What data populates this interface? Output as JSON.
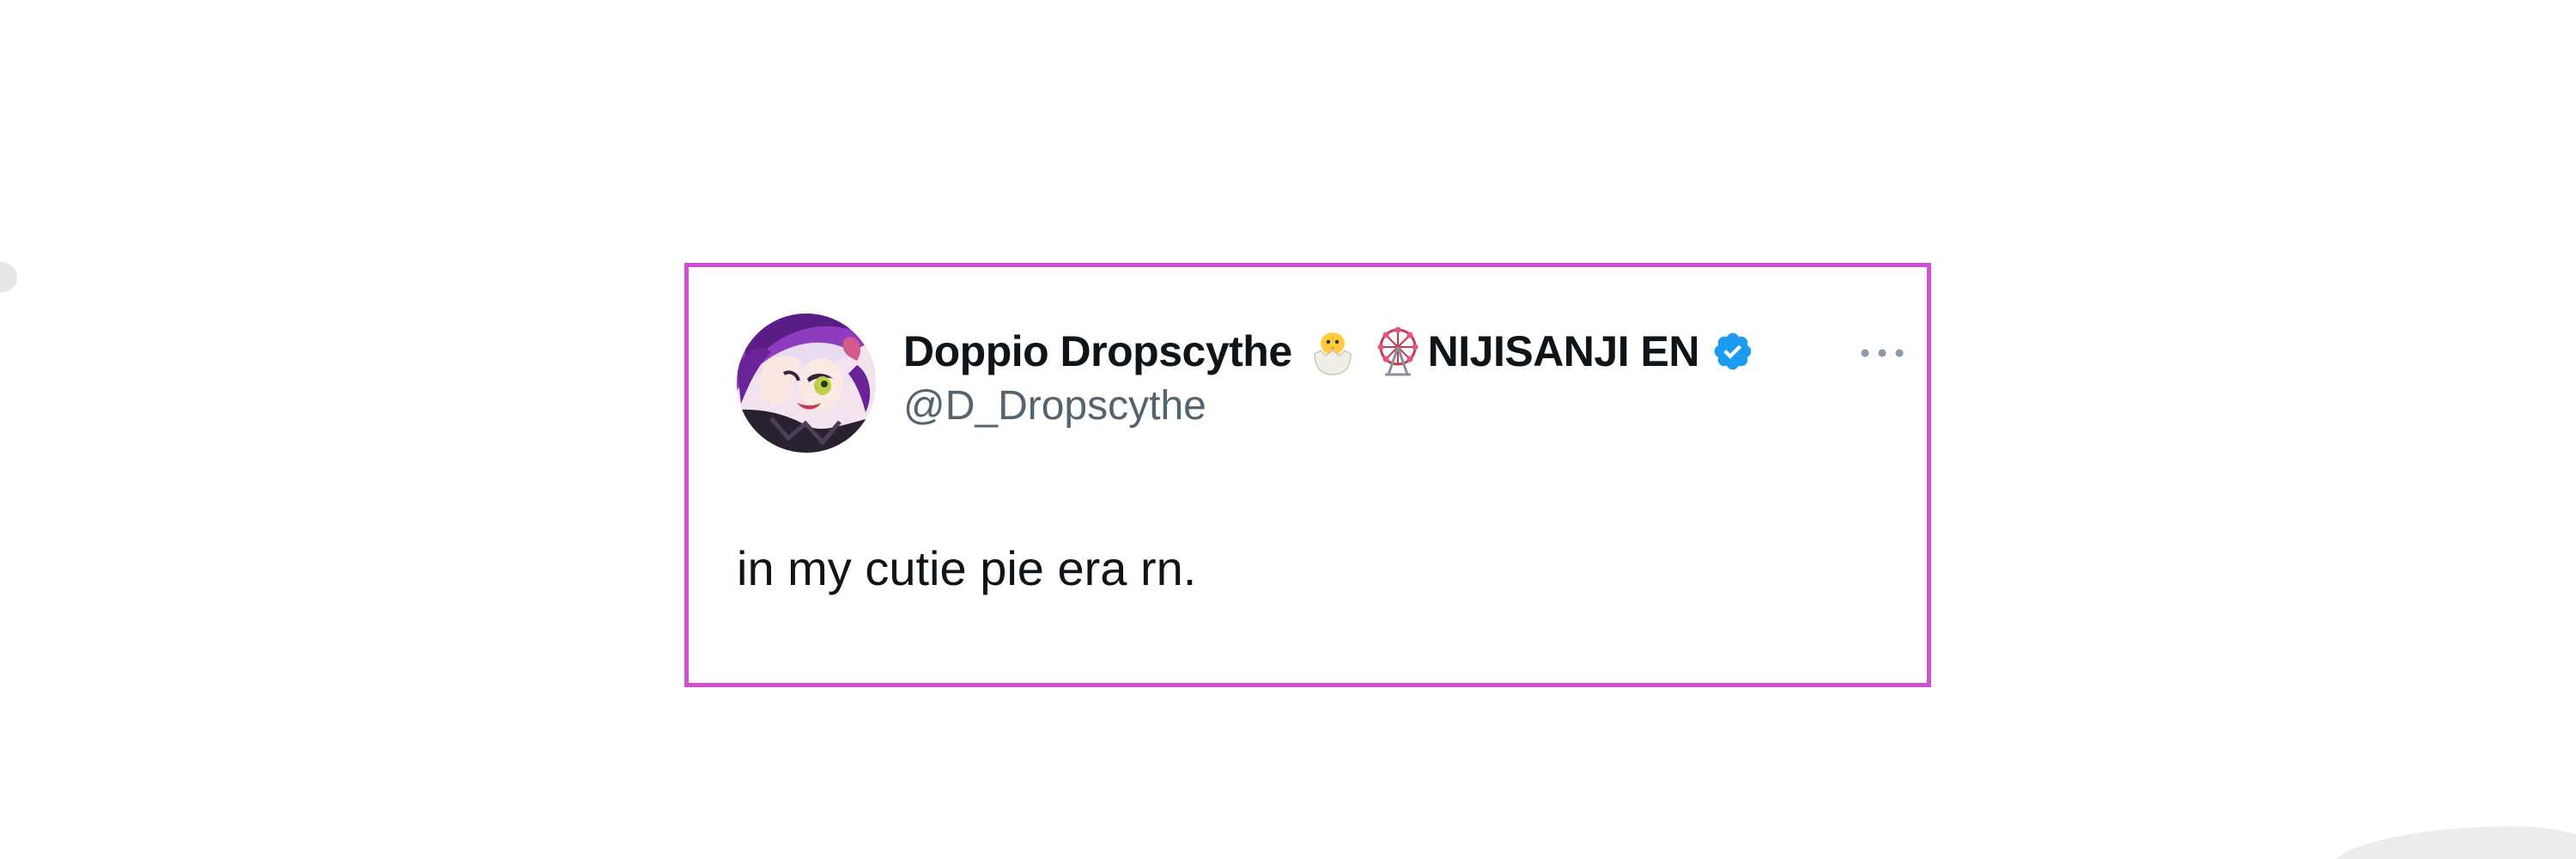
{
  "tweet": {
    "author": {
      "display_name": "Doppio Dropscythe",
      "emojis": [
        "hatching-chick-emoji",
        "ferris-wheel-emoji"
      ],
      "affiliation": "NIJISANJI EN",
      "verified": true,
      "handle": "@D_Dropscythe",
      "avatar_icon": "anime-avatar"
    },
    "text": "in my cutie pie era rn.",
    "more_icon": "more-options-icon"
  },
  "colors": {
    "frame_border": "#d24fd2",
    "name_text": "#0f1419",
    "handle_text": "#536471",
    "verified_badge": "#1d9bf0",
    "avatar_hair": "#7b2ca8"
  }
}
